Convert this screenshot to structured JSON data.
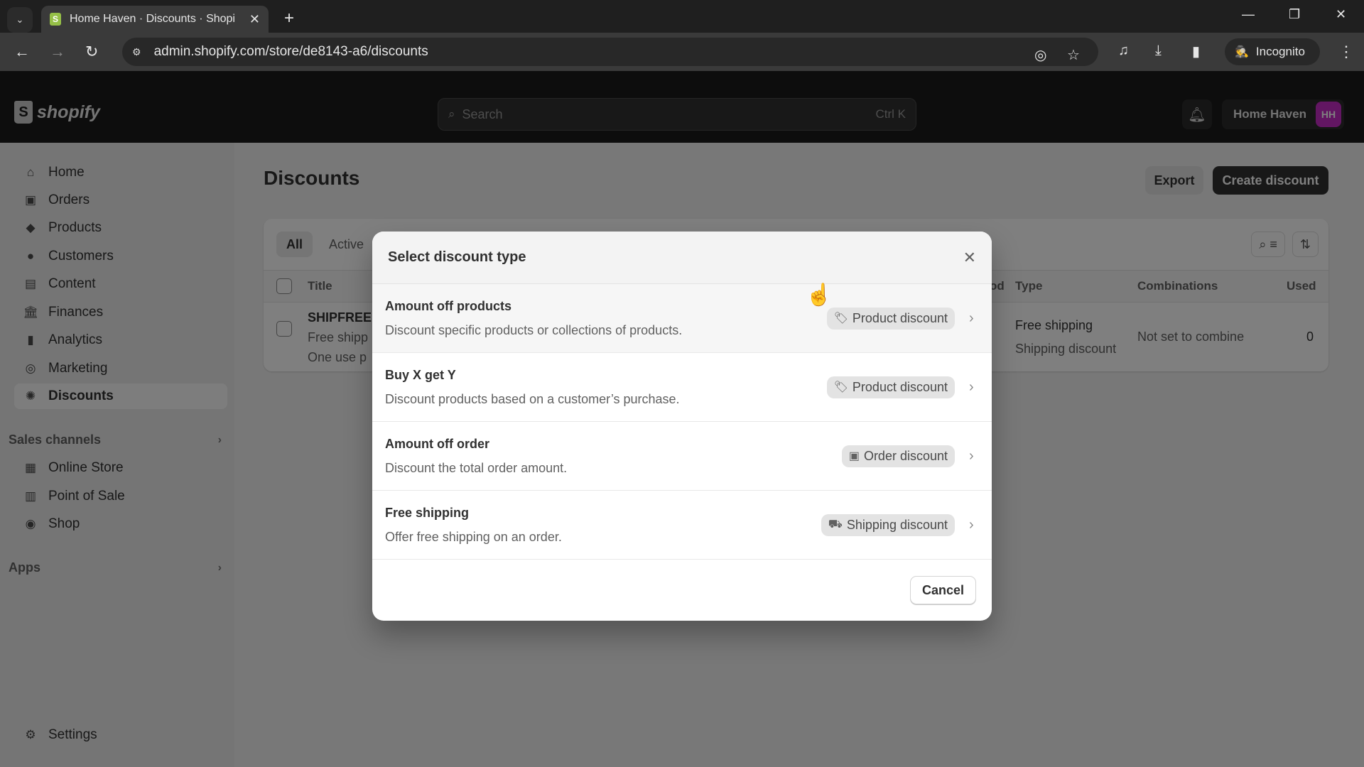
{
  "browser": {
    "tab_title": "Home Haven · Discounts · Shopify",
    "url": "admin.shopify.com/store/de8143-a6/discounts",
    "incognito_label": "Incognito",
    "favicon_letter": "S",
    "icons": {
      "tab_search": "⌄",
      "tab_close": "✕",
      "new_tab": "+",
      "minimize": "—",
      "restore": "❐",
      "close": "✕",
      "back": "←",
      "forward": "→",
      "reload": "↻",
      "site_info": "⚙",
      "eye_off": "◎",
      "star": "☆",
      "media": "♫",
      "download": "⤓",
      "side_panel": "▮",
      "incognito": "🕵",
      "menu": "⋮"
    }
  },
  "topbar": {
    "logo_text": "shopify",
    "logo_letter": "S",
    "search_placeholder": "Search",
    "search_shortcut": "Ctrl K",
    "store_name": "Home Haven",
    "avatar_initials": "HH",
    "avatar_color": "#c42cc4"
  },
  "sidebar": {
    "items": [
      {
        "label": "Home",
        "icon": "⌂"
      },
      {
        "label": "Orders",
        "icon": "▣"
      },
      {
        "label": "Products",
        "icon": "◆"
      },
      {
        "label": "Customers",
        "icon": "●"
      },
      {
        "label": "Content",
        "icon": "▤"
      },
      {
        "label": "Finances",
        "icon": "🏛"
      },
      {
        "label": "Analytics",
        "icon": "▮"
      },
      {
        "label": "Marketing",
        "icon": "◎"
      },
      {
        "label": "Discounts",
        "icon": "✺",
        "active": true
      }
    ],
    "sales_channels_label": "Sales channels",
    "sales_channels": [
      {
        "label": "Online Store",
        "icon": "▦"
      },
      {
        "label": "Point of Sale",
        "icon": "▥"
      },
      {
        "label": "Shop",
        "icon": "◉"
      }
    ],
    "apps_label": "Apps",
    "settings_label": "Settings",
    "settings_icon": "⚙",
    "chevron": "›"
  },
  "main": {
    "page_title": "Discounts",
    "export_label": "Export",
    "create_label": "Create discount",
    "filter_tabs": [
      {
        "label": "All",
        "active": true
      },
      {
        "label": "Active",
        "active": false
      }
    ],
    "tool_icons": {
      "search_filter": "⌕ ≡",
      "sort": "⇅"
    },
    "table": {
      "headers": {
        "title": "Title",
        "method_partial": "od",
        "type": "Type",
        "combinations": "Combinations",
        "used": "Used"
      },
      "rows": [
        {
          "title": "SHIPFREE",
          "line2": "Free shipp",
          "line3": "One use p",
          "type": "Free shipping",
          "type_sub": "Shipping discount",
          "combinations": "Not set to combine",
          "used": "0"
        }
      ]
    }
  },
  "modal": {
    "title": "Select discount type",
    "close_icon": "✕",
    "options": [
      {
        "title": "Amount off products",
        "description": "Discount specific products or collections of products.",
        "badge": "Product discount",
        "badge_icon": "🏷",
        "hover": true
      },
      {
        "title": "Buy X get Y",
        "description": "Discount products based on a customer’s purchase.",
        "badge": "Product discount",
        "badge_icon": "🏷"
      },
      {
        "title": "Amount off order",
        "description": "Discount the total order amount.",
        "badge": "Order discount",
        "badge_icon": "▣"
      },
      {
        "title": "Free shipping",
        "description": "Offer free shipping on an order.",
        "badge": "Shipping discount",
        "badge_icon": "⛟"
      }
    ],
    "chevron": "›",
    "cancel_label": "Cancel"
  },
  "cursor_icon": "☝"
}
